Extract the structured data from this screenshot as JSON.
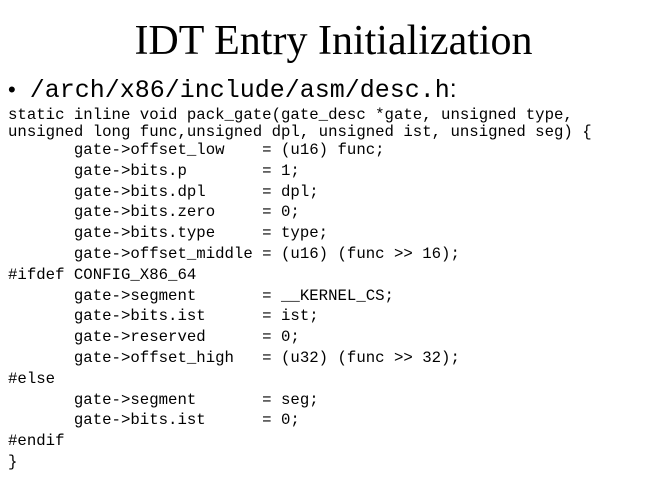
{
  "slide": {
    "title": "IDT Entry Initialization",
    "bullet": {
      "glyph": "•",
      "path": "/arch/x86/include/asm/desc.h",
      "suffix": ":"
    }
  },
  "code": {
    "lines": [
      "static inline void pack_gate(gate_desc *gate, unsigned type,",
      "unsigned long func,unsigned dpl, unsigned ist, unsigned seg) {",
      "       gate->offset_low    = (u16) func;",
      "       gate->bits.p        = 1;",
      "       gate->bits.dpl      = dpl;",
      "       gate->bits.zero     = 0;",
      "       gate->bits.type     = type;",
      "       gate->offset_middle = (u16) (func >> 16);",
      "#ifdef CONFIG_X86_64",
      "       gate->segment       = __KERNEL_CS;",
      "       gate->bits.ist      = ist;",
      "       gate->reserved      = 0;",
      "       gate->offset_high   = (u32) (func >> 32);",
      "#else",
      "       gate->segment       = seg;",
      "       gate->bits.ist      = 0;",
      "#endif",
      "}"
    ]
  }
}
